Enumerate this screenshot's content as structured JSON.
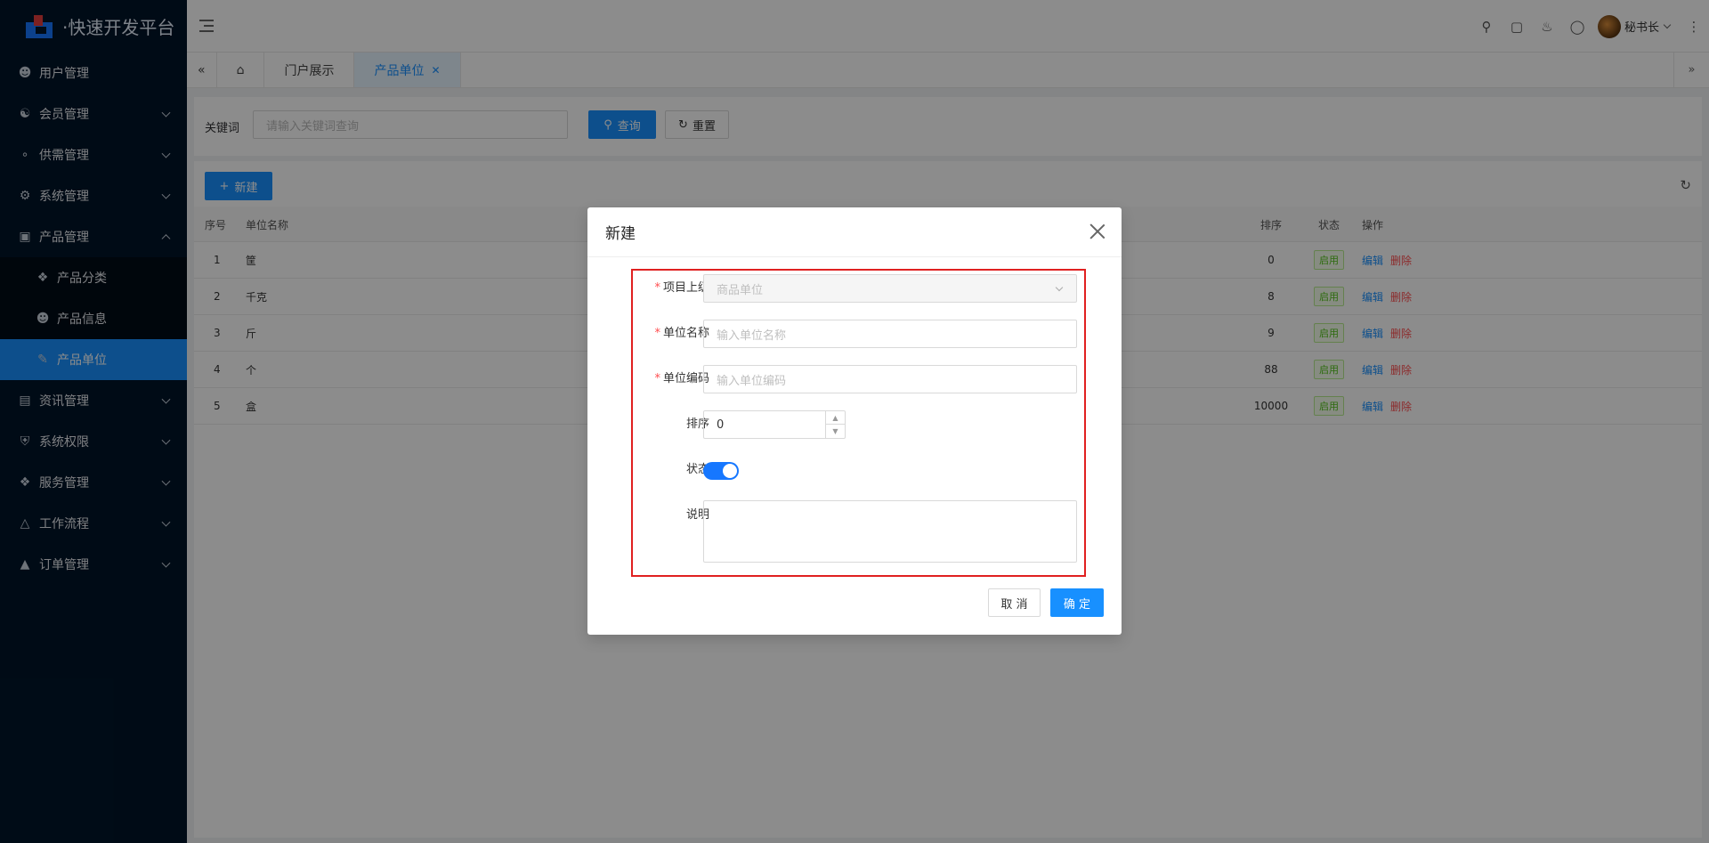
{
  "app": {
    "title": "·快速开发平台"
  },
  "sidebar": {
    "items": [
      {
        "label": "用户管理",
        "icon": "user-icon"
      },
      {
        "label": "会员管理",
        "icon": "members-icon"
      },
      {
        "label": "供需管理",
        "icon": "grid-icon"
      },
      {
        "label": "系统管理",
        "icon": "gear-icon"
      },
      {
        "label": "产品管理",
        "icon": "product-icon"
      },
      {
        "label": "资讯管理",
        "icon": "document-icon"
      },
      {
        "label": "系统权限",
        "icon": "shield-icon"
      },
      {
        "label": "服务管理",
        "icon": "grid-icon"
      },
      {
        "label": "工作流程",
        "icon": "workflow-icon"
      },
      {
        "label": "订单管理",
        "icon": "triangle-icon"
      }
    ],
    "product_submenu": [
      {
        "label": "产品分类",
        "icon": "category-icon"
      },
      {
        "label": "产品信息",
        "icon": "user-icon"
      },
      {
        "label": "产品单位",
        "icon": "edit-icon"
      }
    ]
  },
  "header": {
    "user_name": "秘书长"
  },
  "tabs": [
    {
      "label": "门户展示"
    },
    {
      "label": "产品单位"
    }
  ],
  "search": {
    "keyword_label": "关键词",
    "keyword_placeholder": "请输入关键词查询",
    "query_label": "查询",
    "reset_label": "重置"
  },
  "table": {
    "new_label": "新建",
    "columns": [
      "序号",
      "单位名称",
      "排序",
      "状态",
      "操作"
    ],
    "rows": [
      {
        "idx": "1",
        "name": "筐",
        "sort": "0",
        "status": "启用"
      },
      {
        "idx": "2",
        "name": "千克",
        "sort": "8",
        "status": "启用"
      },
      {
        "idx": "3",
        "name": "斤",
        "sort": "9",
        "status": "启用"
      },
      {
        "idx": "4",
        "name": "个",
        "sort": "88",
        "status": "启用"
      },
      {
        "idx": "5",
        "name": "盒",
        "sort": "10000",
        "status": "启用"
      }
    ],
    "edit_label": "编辑",
    "delete_label": "删除"
  },
  "modal": {
    "title": "新建",
    "parent_label": "项目上级",
    "parent_value": "商品单位",
    "name_label": "单位名称",
    "name_placeholder": "输入单位名称",
    "code_label": "单位编码",
    "code_placeholder": "输入单位编码",
    "sort_label": "排序",
    "sort_value": "0",
    "status_label": "状态",
    "status_on": true,
    "desc_label": "说明",
    "cancel_label": "取 消",
    "ok_label": "确 定"
  },
  "colors": {
    "primary": "#1890ff",
    "sidebar_bg": "#001529",
    "danger": "#ff4d4f",
    "highlight": "#e02020"
  }
}
